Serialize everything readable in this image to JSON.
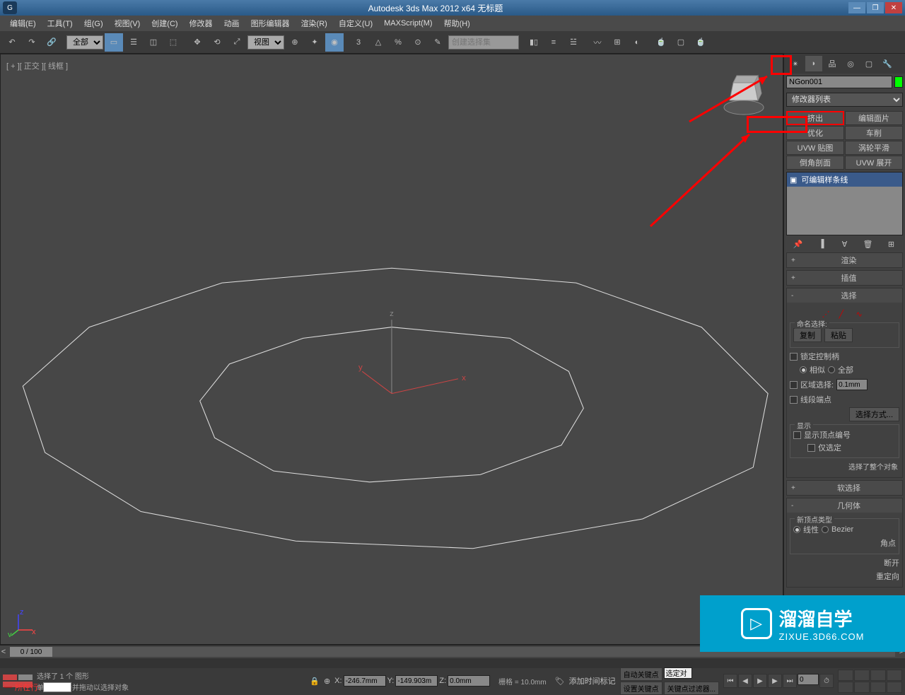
{
  "titlebar": {
    "title": "Autodesk 3ds Max  2012 x64    无标题"
  },
  "menu": {
    "items": [
      "编辑(E)",
      "工具(T)",
      "组(G)",
      "视图(V)",
      "创建(C)",
      "修改器",
      "动画",
      "图形编辑器",
      "渲染(R)",
      "自定义(U)",
      "MAXScript(M)",
      "帮助(H)"
    ]
  },
  "toolbar": {
    "filter_select": "全部",
    "view_select": "视图",
    "selection_set_placeholder": "创建选择集"
  },
  "viewport": {
    "label": "[ + ][ 正交 ][ 线框 ]",
    "axis_x": "x",
    "axis_y": "y",
    "axis_z": "z"
  },
  "panel": {
    "object_name": "NGon001",
    "modifier_list": "修改器列表",
    "mod_buttons": [
      "挤出",
      "编辑面片",
      "优化",
      "车削",
      "UVW 贴图",
      "涡轮平滑",
      "倒角剖面",
      "UVW 展开"
    ],
    "stack_item": "可编辑样条线"
  },
  "rollouts": {
    "render": "渲染",
    "interp": "插值",
    "selection": {
      "title": "选择",
      "named_sel": "命名选择:",
      "copy": "复制",
      "paste": "粘贴",
      "lock_handles": "锁定控制柄",
      "similar": "相似",
      "all": "全部",
      "area_sel": "区域选择:",
      "area_val": "0.1mm",
      "segment_end": "线段端点",
      "sel_method": "选择方式...",
      "display": "显示",
      "show_vert_num": "显示顶点编号",
      "only_sel": "仅选定",
      "status": "选择了整个对象"
    },
    "soft_sel": "软选择",
    "geometry": {
      "title": "几何体",
      "new_vert_type": "新顶点类型",
      "linear": "线性",
      "bezier": "Bezier",
      "corner": "角点",
      "break": "断开",
      "reorient": "重定向"
    }
  },
  "timeline": {
    "frame": "0 / 100"
  },
  "status": {
    "prompt1": "选择了 1 个 图形",
    "prompt2": "单击或单击并拖动以选择对象",
    "x_label": "X:",
    "x_val": "-246.7mm",
    "y_label": "Y:",
    "y_val": "-149.903m",
    "z_label": "Z:",
    "z_val": "0.0mm",
    "grid": "栅格 = 10.0mm",
    "add_time_tag": "添加时间标记",
    "auto_key": "自动关键点",
    "set_key": "设置关键点",
    "selected": "选定对",
    "key_filter": "关键点过滤器...",
    "frame_val": "0"
  },
  "where": {
    "label": "所在行:"
  },
  "watermark": {
    "big": "溜溜自学",
    "small": "ZIXUE.3D66.COM"
  }
}
